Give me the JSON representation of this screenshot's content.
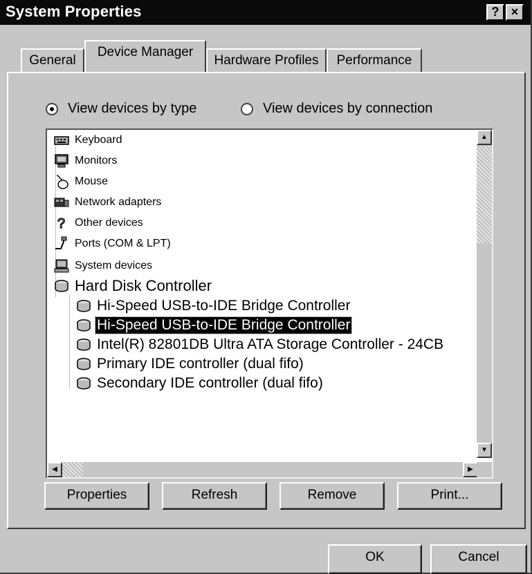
{
  "window": {
    "title": "System Properties",
    "help_button": "?",
    "close_button": "×"
  },
  "tabs": [
    {
      "label": "General",
      "active": false
    },
    {
      "label": "Device Manager",
      "active": true
    },
    {
      "label": "Hardware Profiles",
      "active": false
    },
    {
      "label": "Performance",
      "active": false
    }
  ],
  "view_options": {
    "by_type": {
      "label": "View devices by type",
      "checked": true
    },
    "by_connection": {
      "label": "View devices by connection",
      "checked": false
    }
  },
  "device_tree": [
    {
      "label": "Keyboard",
      "icon": "keyboard-icon"
    },
    {
      "label": "Monitors",
      "icon": "monitor-icon"
    },
    {
      "label": "Mouse",
      "icon": "mouse-icon"
    },
    {
      "label": "Network adapters",
      "icon": "network-adapter-icon"
    },
    {
      "label": "Other devices",
      "icon": "question-mark-icon"
    },
    {
      "label": "Ports (COM & LPT)",
      "icon": "port-icon"
    },
    {
      "label": "System devices",
      "icon": "computer-icon"
    },
    {
      "label": "Hard Disk Controller",
      "icon": "disk-controller-icon",
      "expanded": true,
      "children": [
        {
          "label": "Hi-Speed USB-to-IDE Bridge Controller",
          "icon": "disk-controller-icon",
          "selected": false
        },
        {
          "label": "Hi-Speed USB-to-IDE Bridge Controller",
          "icon": "disk-controller-icon",
          "selected": true
        },
        {
          "label": "Intel(R) 82801DB Ultra ATA Storage Controller - 24CB",
          "icon": "disk-controller-icon",
          "selected": false
        },
        {
          "label": "Primary IDE controller (dual fifo)",
          "icon": "disk-controller-icon",
          "selected": false
        },
        {
          "label": "Secondary IDE controller (dual fifo)",
          "icon": "disk-controller-icon",
          "selected": false
        }
      ]
    }
  ],
  "actions": {
    "properties": "Properties",
    "refresh": "Refresh",
    "remove": "Remove",
    "print": "Print..."
  },
  "dialog_buttons": {
    "ok": "OK",
    "cancel": "Cancel"
  }
}
